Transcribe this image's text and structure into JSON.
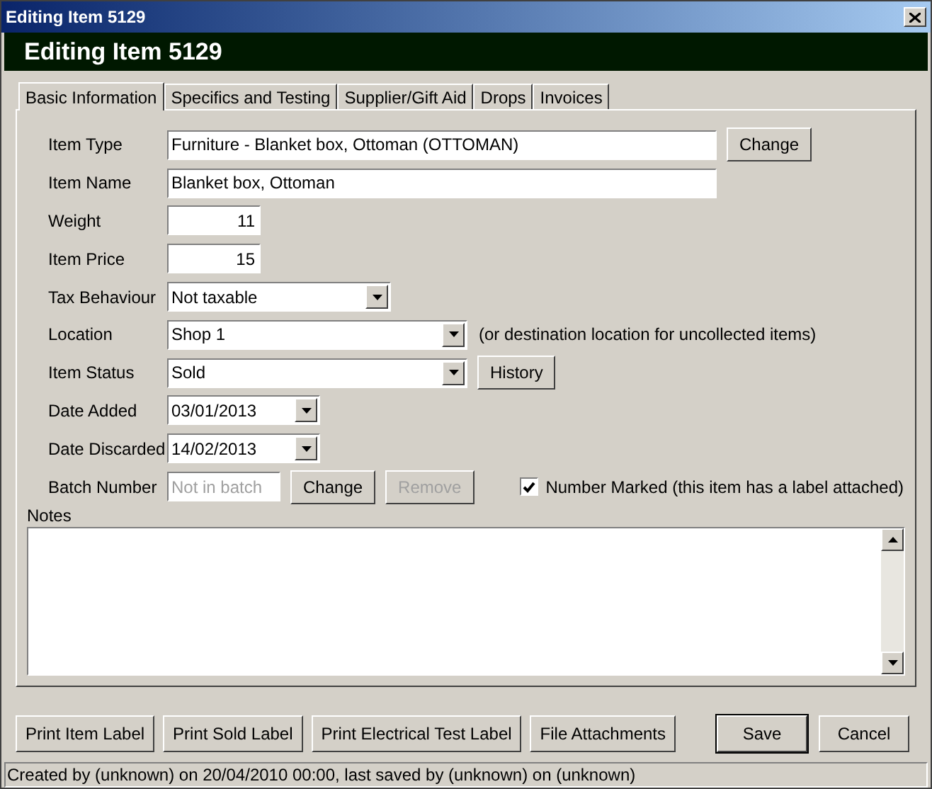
{
  "window": {
    "title": "Editing Item 5129"
  },
  "header": {
    "title": "Editing Item 5129"
  },
  "tabs": [
    {
      "label": "Basic Information",
      "selected": true
    },
    {
      "label": "Specifics and Testing",
      "selected": false
    },
    {
      "label": "Supplier/Gift Aid",
      "selected": false
    },
    {
      "label": "Drops",
      "selected": false
    },
    {
      "label": "Invoices",
      "selected": false
    }
  ],
  "fields": [
    {
      "kind": "text",
      "label": "Item Type",
      "value": "Furniture - Blanket box, Ottoman (OTTOMAN)",
      "buttons": [
        {
          "label": "Change",
          "disabled": false
        }
      ]
    },
    {
      "kind": "text",
      "label": "Item Name",
      "value": "Blanket box, Ottoman"
    },
    {
      "kind": "number",
      "label": "Weight",
      "value": "11"
    },
    {
      "kind": "number",
      "label": "Item Price",
      "value": "15"
    },
    {
      "kind": "dropdown",
      "label": "Tax Behaviour",
      "value": "Not taxable"
    },
    {
      "kind": "combo",
      "label": "Location",
      "value": "Shop 1",
      "note": "(or destination location for uncollected items)"
    },
    {
      "kind": "combo",
      "label": "Item Status",
      "value": "Sold",
      "buttons": [
        {
          "label": "History",
          "disabled": false
        }
      ]
    },
    {
      "kind": "date",
      "label": "Date Added",
      "value": "03/01/2013"
    },
    {
      "kind": "date",
      "label": "Date Discarded",
      "value": "14/02/2013"
    },
    {
      "kind": "batch",
      "label": "Batch Number",
      "placeholder": "Not in batch",
      "buttons": [
        {
          "label": "Change",
          "disabled": false
        },
        {
          "label": "Remove",
          "disabled": true
        }
      ]
    }
  ],
  "number_marked": {
    "label": "Number Marked (this item has a label attached)",
    "checked": true
  },
  "notes": {
    "label": "Notes"
  },
  "buttons": [
    {
      "label": "Print Item Label",
      "default": false
    },
    {
      "label": "Print Sold Label",
      "default": false
    },
    {
      "label": "Print Electrical Test Label",
      "default": false
    },
    {
      "label": "File Attachments",
      "default": false
    }
  ],
  "dialog_buttons": [
    {
      "label": "Save",
      "default": true
    },
    {
      "label": "Cancel",
      "default": false
    }
  ],
  "status_bar": "Created by (unknown) on 20/04/2010 00:00, last saved by (unknown) on (unknown)"
}
